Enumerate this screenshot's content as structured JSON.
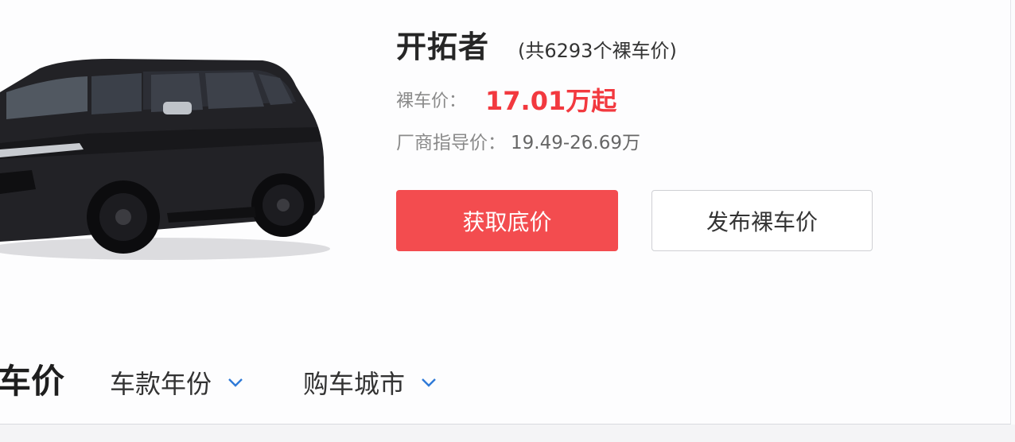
{
  "colors": {
    "accent_red": "#f34c4f",
    "price_red": "#f2393f",
    "chevron_blue": "#2f7ad8"
  },
  "car": {
    "image": "black-suv-icon",
    "name": "开拓者",
    "total_count": "(共6293个裸车价)"
  },
  "price": {
    "label": "裸车价：",
    "value": "17.01万起"
  },
  "guide": {
    "label": "厂商指导价：",
    "value": "19.49-26.69万"
  },
  "actions": {
    "primary_label": "获取底价",
    "secondary_label": "发布裸车价"
  },
  "section": {
    "title": "车价",
    "filters": [
      {
        "label": "车款年份",
        "icon": "chevron-down-icon"
      },
      {
        "label": "购车城市",
        "icon": "chevron-down-icon"
      }
    ]
  }
}
